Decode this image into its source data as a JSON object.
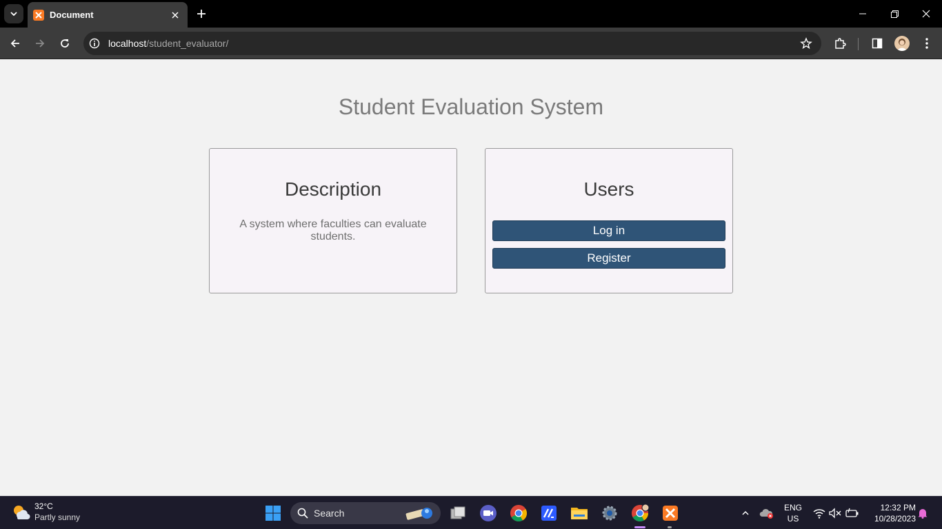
{
  "browser": {
    "tab_title": "Document",
    "url_host": "localhost",
    "url_path": "/student_evaluator/"
  },
  "page": {
    "title": "Student Evaluation System",
    "description_card": {
      "heading": "Description",
      "text": "A system where faculties can evaluate students."
    },
    "users_card": {
      "heading": "Users",
      "login_label": "Log in",
      "register_label": "Register"
    }
  },
  "taskbar": {
    "weather_temp": "32°C",
    "weather_condition": "Partly sunny",
    "search_label": "Search",
    "language_line1": "ENG",
    "language_line2": "US",
    "time": "12:32 PM",
    "date": "10/28/2023"
  },
  "colors": {
    "button_bg": "#2f5477",
    "card_bg": "#f7f3f8",
    "page_bg": "#f2f2f2",
    "tab_accent": "#fb7a24"
  }
}
